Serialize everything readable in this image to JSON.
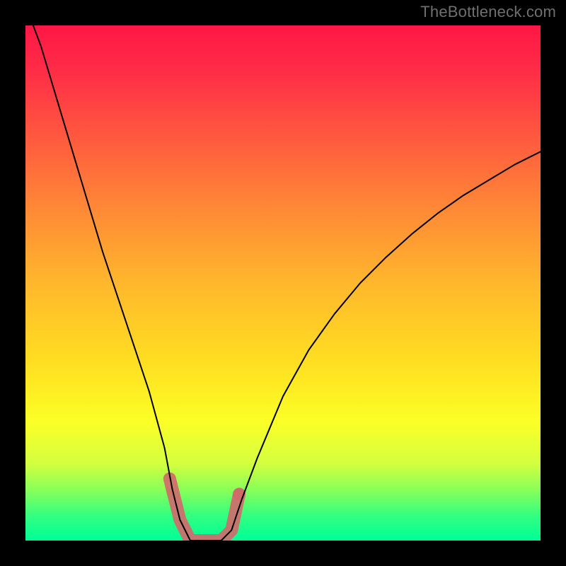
{
  "watermark": "TheBottleneck.com",
  "chart_data": {
    "type": "line",
    "title": "",
    "xlabel": "",
    "ylabel": "",
    "xlim": [
      0,
      100
    ],
    "ylim": [
      0,
      100
    ],
    "grid": false,
    "legend": false,
    "background_gradient": {
      "top": "#ff1745",
      "middle": "#ffe021",
      "bottom": "#00ff99"
    },
    "series": [
      {
        "name": "bottleneck_curve",
        "color": "#000000",
        "x": [
          0,
          3,
          6,
          9,
          12,
          15,
          18,
          21,
          24,
          27,
          28.5,
          30,
          32,
          34,
          36,
          38,
          40,
          42,
          45,
          50,
          55,
          60,
          65,
          70,
          75,
          80,
          85,
          90,
          95,
          100
        ],
        "y": [
          104,
          96,
          86,
          76,
          66,
          56,
          47,
          38,
          29,
          18,
          10,
          4,
          0,
          0,
          0,
          0,
          2,
          8,
          16,
          28,
          37,
          44,
          50,
          55,
          59.5,
          63.5,
          67,
          70,
          73,
          75.5
        ]
      }
    ],
    "markers": {
      "name": "highlight",
      "color": "#cf6b6b",
      "shape": "line_with_dots",
      "x": [
        28,
        30,
        32,
        34,
        36,
        38,
        40,
        41.5
      ],
      "y": [
        12,
        4,
        0,
        0,
        0,
        0,
        2,
        9
      ]
    }
  }
}
